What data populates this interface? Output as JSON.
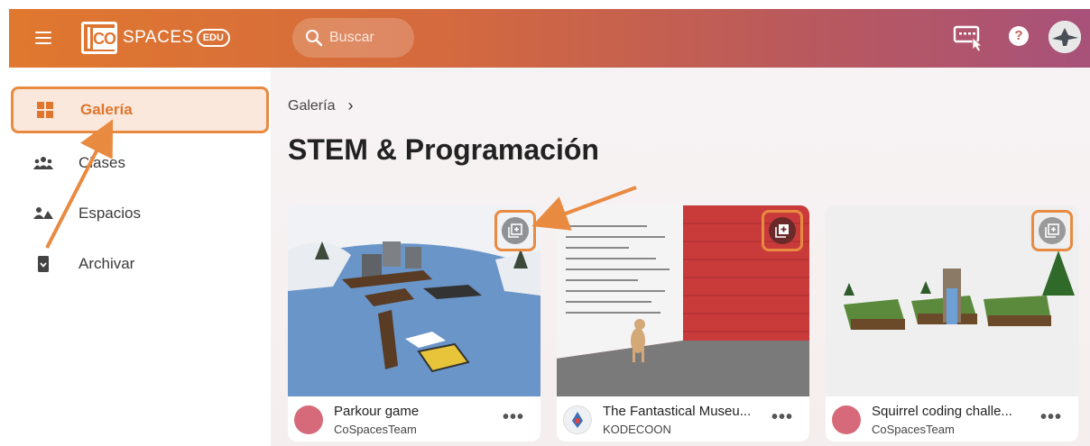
{
  "app": {
    "logo_text": "SPACES",
    "logo_co": "CO",
    "logo_edu": "EDU"
  },
  "search": {
    "placeholder": "Buscar"
  },
  "colors": {
    "accent": "#e98a41",
    "brand": "#e0782f",
    "header_end": "#a8527a"
  },
  "sidebar": {
    "items": [
      {
        "label": "Galería",
        "icon": "gallery-grid-icon",
        "active": true
      },
      {
        "label": "Clases",
        "icon": "people-icon",
        "active": false
      },
      {
        "label": "Espacios",
        "icon": "spaces-icon",
        "active": false
      },
      {
        "label": "Archivar",
        "icon": "archive-icon",
        "active": false
      }
    ]
  },
  "main": {
    "breadcrumb": "Galería",
    "title": "STEM & Programación",
    "cards": [
      {
        "title": "Parkour game",
        "author": "CoSpacesTeam"
      },
      {
        "title": "The Fantastical Museu...",
        "author": "KODECOON"
      },
      {
        "title": "Squirrel coding challe...",
        "author": "CoSpacesTeam"
      }
    ]
  }
}
